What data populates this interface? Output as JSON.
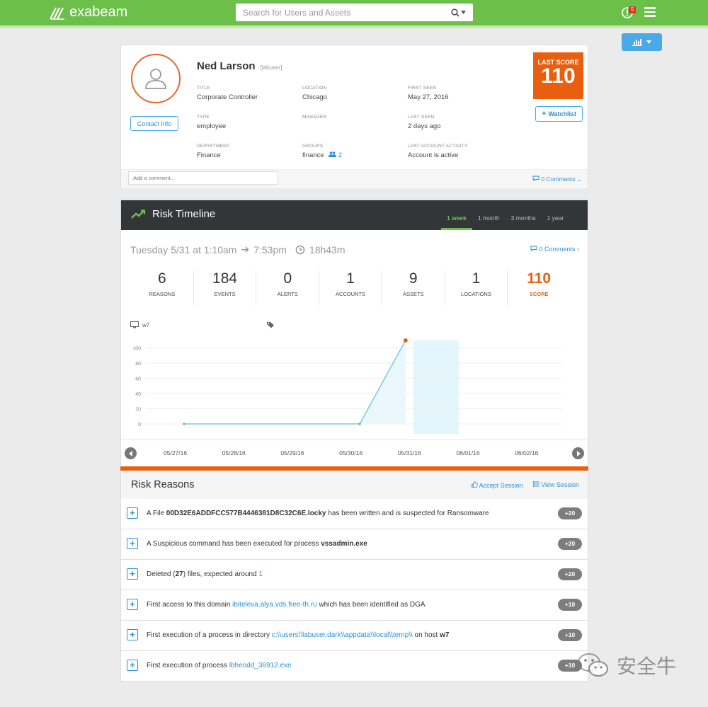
{
  "app": {
    "brand": "exabeam",
    "alert_count": "5"
  },
  "search": {
    "placeholder": "Search for Users and Assets"
  },
  "profile": {
    "name": "Ned Larson",
    "handle": "[labuser]",
    "contact_btn": "Contact Info",
    "fields": {
      "title": {
        "label": "TITLE",
        "value": "Corporate Controller"
      },
      "location": {
        "label": "LOCATION",
        "value": "Chicago"
      },
      "first_seen": {
        "label": "FIRST SEEN",
        "value": "May 27, 2016"
      },
      "type": {
        "label": "TYPE",
        "value": "employee"
      },
      "manager": {
        "label": "MANAGER",
        "value": ""
      },
      "last_seen": {
        "label": "LAST SEEN",
        "value": "2 days ago"
      },
      "department": {
        "label": "DEPARTMENT",
        "value": "Finance"
      },
      "groups": {
        "label": "GROUPS",
        "value": "finance",
        "count": "2"
      },
      "last_activity": {
        "label": "LAST ACCOUNT ACTIVITY",
        "value": "Account is active"
      }
    },
    "last_score_label": "LAST SCORE",
    "last_score": "110",
    "watchlist_btn": "Watchlist",
    "comment_placeholder": "Add a comment...",
    "comments_link": "0 Comments"
  },
  "timeline": {
    "title": "Risk Timeline",
    "tabs": [
      "1 week",
      "1 month",
      "3 months",
      "1 year"
    ],
    "session": {
      "day": "Tuesday 5/31 at 1:10am",
      "end": "7:53pm",
      "duration": "18h43m"
    },
    "comments_link": "0 Comments",
    "stats": [
      {
        "value": "6",
        "label": "REASONS"
      },
      {
        "value": "184",
        "label": "EVENTS"
      },
      {
        "value": "0",
        "label": "ALERTS"
      },
      {
        "value": "1",
        "label": "ACCOUNTS"
      },
      {
        "value": "9",
        "label": "ASSETS"
      },
      {
        "value": "1",
        "label": "LOCATIONS"
      },
      {
        "value": "110",
        "label": "SCORE"
      }
    ],
    "host": "w7",
    "dates": [
      "05/27/16",
      "05/28/16",
      "05/29/16",
      "05/30/16",
      "05/31/16",
      "06/01/16",
      "06/02/16"
    ]
  },
  "chart_data": {
    "type": "line",
    "y_ticks": [
      0,
      20,
      40,
      60,
      80,
      100
    ],
    "ylim": [
      0,
      110
    ],
    "x": [
      "05/27/16",
      "05/28/16",
      "05/29/16",
      "05/30/16",
      "05/31/16",
      "06/01/16",
      "06/02/16"
    ],
    "points": [
      {
        "x": "05/27/16",
        "y": 0
      },
      {
        "x": "05/30/16",
        "y": 0
      },
      {
        "x": "05/31/16",
        "y": 110
      }
    ],
    "highlight_range": [
      "05/31/16",
      "05/31/16"
    ],
    "colors": {
      "line": "#5bc0de",
      "start_point": "#6cc04a",
      "end_point": "#e8600f",
      "highlight": "#e2f6fc"
    }
  },
  "reasons": {
    "title": "Risk Reasons",
    "accept_session": "Accept Session",
    "view_session": "View Session",
    "items": [
      {
        "pre": "A File ",
        "bold": "00D32E6ADDFCC577B4446381D8C32C6E.locky",
        "post": " has been written and is suspected for Ransomware",
        "points": "+20"
      },
      {
        "pre": "A Suspicious command has been executed for process ",
        "bold": "vssadmin.exe",
        "post": "",
        "points": "+20"
      },
      {
        "pre": "Deleted (",
        "bold": "27",
        "post": ") files, expected around ",
        "link": "1",
        "points": "+20"
      },
      {
        "pre": "First access to this domain ",
        "link": "ibiteleva.alya.vds.free-th.ru",
        "post": " which has been identified as DGA",
        "points": "+10"
      },
      {
        "pre": "First execution of a process in directory ",
        "link": "c:\\\\users\\\\labuser.dark\\\\appdata\\\\local\\\\temp\\\\",
        "post": " on host ",
        "bold": "w7",
        "points": "+10"
      },
      {
        "pre": "First execution of process ",
        "link": "lbheodd_36912.exe",
        "post": "",
        "points": "+10"
      }
    ]
  },
  "watermark": "安全牛"
}
